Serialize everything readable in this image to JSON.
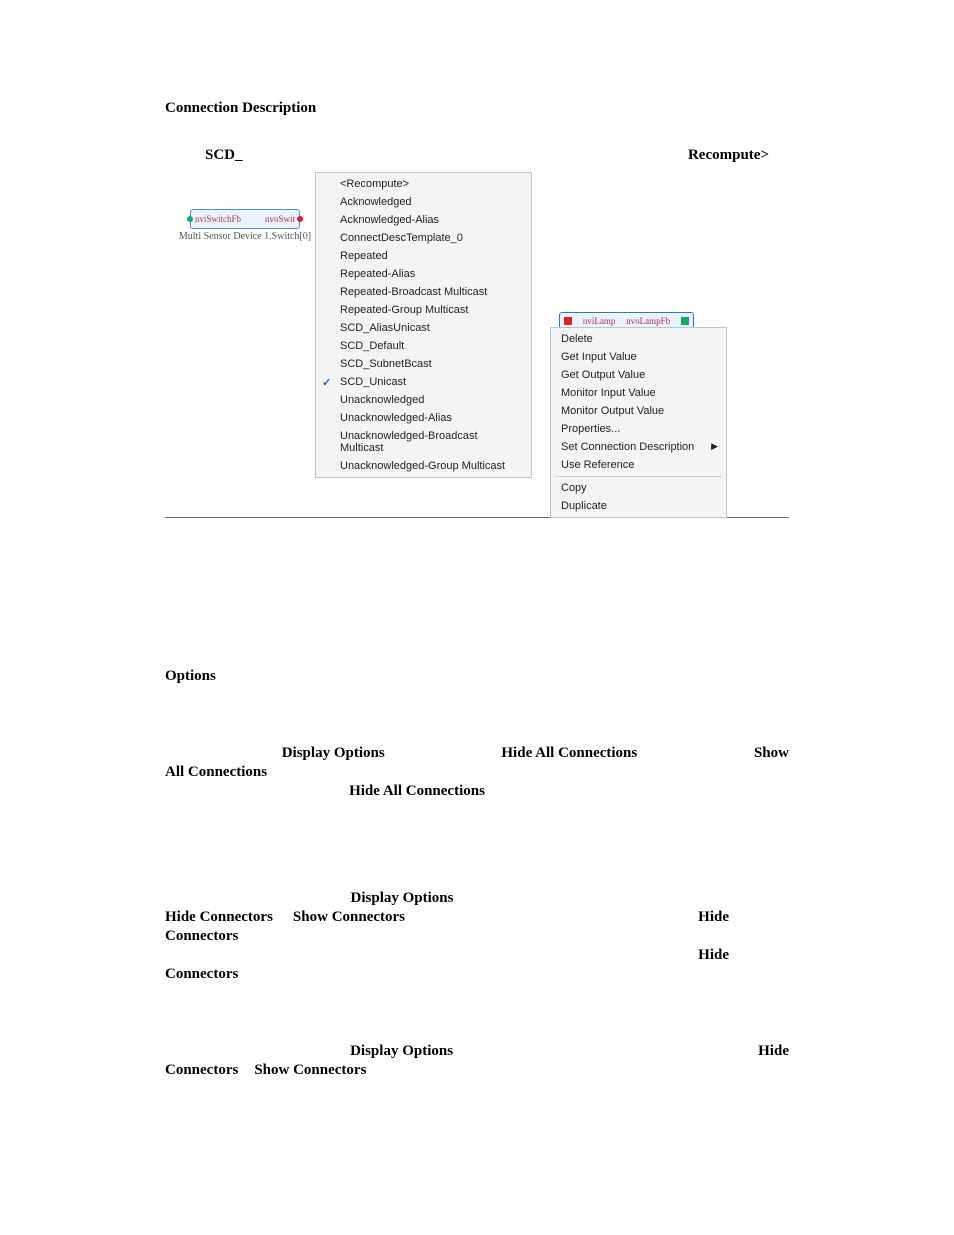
{
  "heading": "Connection Description",
  "labels": {
    "scd": "SCD_",
    "recompute": "Recompute>"
  },
  "diagram_left": {
    "fb_left": "nviSwitchFb",
    "fb_right": "nvoSwit",
    "caption": "Multi Sensor Device 1.Switch[0]"
  },
  "dropdown": {
    "items": [
      "<Recompute>",
      "Acknowledged",
      "Acknowledged-Alias",
      "ConnectDescTemplate_0",
      "Repeated",
      "Repeated-Alias",
      "Repeated-Broadcast Multicast",
      "Repeated-Group Multicast",
      "SCD_AliasUnicast",
      "SCD_Default",
      "SCD_SubnetBcast",
      "SCD_Unicast",
      "Unacknowledged",
      "Unacknowledged-Alias",
      "Unacknowledged-Broadcast Multicast",
      "Unacknowledged-Group Multicast"
    ],
    "checked_index": 11
  },
  "lamp_node": {
    "left": "nviLamp",
    "right": "nvoLampFb"
  },
  "context_menu": {
    "group1": [
      "Delete",
      "Get Input Value",
      "Get Output Value",
      "Monitor Input Value",
      "Monitor Output Value",
      "Properties...",
      "Set Connection Description",
      "Use Reference"
    ],
    "submenu_index": 6,
    "group2": [
      "Copy",
      "Duplicate"
    ]
  },
  "options_heading": "Options",
  "body_lines": {
    "b1": {
      "a": "Display Options",
      "b": "Hide All Connections",
      "c": "Show"
    },
    "b2": "All Connections",
    "b3": "Hide All Connections",
    "c1": {
      "a": "Display Options"
    },
    "c2": {
      "a": "Hide Connectors",
      "b": "Show Connectors",
      "c": "Hide"
    },
    "c3": "Connectors",
    "c4": "Hide",
    "c5": "Connectors",
    "d1": {
      "a": "Display Options",
      "b": "Hide"
    },
    "d2": {
      "a": "Connectors",
      "b": "Show Connectors"
    }
  }
}
